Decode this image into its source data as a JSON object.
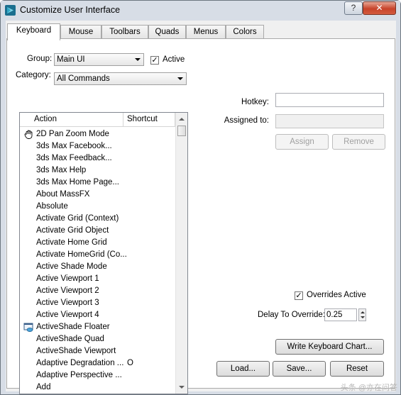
{
  "window": {
    "title": "Customize User Interface",
    "help_label": "?",
    "close_label": "✕"
  },
  "tabs": [
    {
      "label": "Keyboard",
      "active": true
    },
    {
      "label": "Mouse"
    },
    {
      "label": "Toolbars"
    },
    {
      "label": "Quads"
    },
    {
      "label": "Menus"
    },
    {
      "label": "Colors"
    }
  ],
  "group": {
    "label": "Group:",
    "value": "Main UI"
  },
  "active_checkbox": {
    "label": "Active",
    "checked": true
  },
  "category": {
    "label": "Category:",
    "value": "All Commands"
  },
  "list": {
    "headers": {
      "action": "Action",
      "shortcut": "Shortcut"
    },
    "rows": [
      {
        "action": "2D Pan Zoom Mode",
        "shortcut": "",
        "icon": "hand-pan-icon"
      },
      {
        "action": "3ds Max Facebook...",
        "shortcut": ""
      },
      {
        "action": "3ds Max Feedback...",
        "shortcut": ""
      },
      {
        "action": "3ds Max Help",
        "shortcut": ""
      },
      {
        "action": "3ds Max Home Page...",
        "shortcut": ""
      },
      {
        "action": "About MassFX",
        "shortcut": ""
      },
      {
        "action": "Absolute",
        "shortcut": ""
      },
      {
        "action": "Activate Grid (Context)",
        "shortcut": ""
      },
      {
        "action": "Activate Grid Object",
        "shortcut": ""
      },
      {
        "action": "Activate Home Grid",
        "shortcut": ""
      },
      {
        "action": "Activate HomeGrid (Co...",
        "shortcut": ""
      },
      {
        "action": "Active Shade Mode",
        "shortcut": ""
      },
      {
        "action": "Active Viewport 1",
        "shortcut": ""
      },
      {
        "action": "Active Viewport 2",
        "shortcut": ""
      },
      {
        "action": "Active Viewport 3",
        "shortcut": ""
      },
      {
        "action": "Active Viewport 4",
        "shortcut": ""
      },
      {
        "action": "ActiveShade Floater",
        "shortcut": "",
        "icon": "activeshade-floater-icon"
      },
      {
        "action": "ActiveShade Quad",
        "shortcut": ""
      },
      {
        "action": "ActiveShade Viewport",
        "shortcut": ""
      },
      {
        "action": "Adaptive Degradation ...",
        "shortcut": "O"
      },
      {
        "action": "Adaptive Perspective ...",
        "shortcut": ""
      },
      {
        "action": "Add",
        "shortcut": ""
      }
    ]
  },
  "hotkey": {
    "label": "Hotkey:",
    "value": ""
  },
  "assigned_to": {
    "label": "Assigned to:",
    "value": ""
  },
  "buttons": {
    "assign": "Assign",
    "remove": "Remove",
    "write_chart": "Write Keyboard Chart...",
    "load": "Load...",
    "save": "Save...",
    "reset": "Reset"
  },
  "overrides": {
    "label": "Overrides Active",
    "checked": true
  },
  "delay": {
    "label": "Delay To Override:",
    "value": "0.25"
  },
  "watermark": "头条 @亦在问答"
}
